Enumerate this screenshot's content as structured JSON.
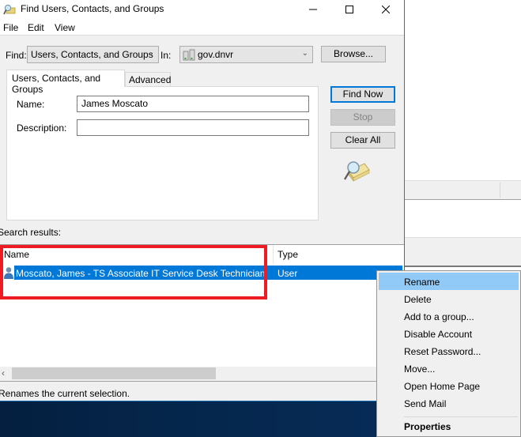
{
  "window": {
    "title": "Find Users, Contacts, and Groups",
    "controls": [
      "minimize",
      "maximize",
      "close"
    ]
  },
  "menubar": {
    "items": [
      "File",
      "Edit",
      "View"
    ]
  },
  "find": {
    "find_label": "Find:",
    "find_value": "Users, Contacts, and Groups",
    "in_label": "In:",
    "in_value": "gov.dnvr",
    "browse_label": "Browse..."
  },
  "tabs": [
    {
      "label": "Users, Contacts, and Groups",
      "active": true
    },
    {
      "label": "Advanced",
      "active": false
    }
  ],
  "form": {
    "name_label": "Name:",
    "name_value": "James Moscato",
    "description_label": "Description:",
    "description_value": ""
  },
  "buttons": {
    "find_now": "Find Now",
    "stop": "Stop",
    "clear_all": "Clear All"
  },
  "results": {
    "label": "Search results:",
    "columns": [
      "Name",
      "Type"
    ],
    "rows": [
      {
        "name": "Moscato, James - TS Associate IT Service Desk Technician",
        "type": "User",
        "selected": true
      }
    ]
  },
  "status": {
    "text": "Renames the current selection."
  },
  "context_menu": {
    "items": [
      {
        "label": "Rename",
        "highlighted": true
      },
      {
        "label": "Delete"
      },
      {
        "label": "Add to a group..."
      },
      {
        "label": "Disable Account"
      },
      {
        "label": "Reset Password..."
      },
      {
        "label": "Move..."
      },
      {
        "label": "Open Home Page"
      },
      {
        "label": "Send Mail"
      },
      {
        "label": "Properties",
        "bold": true
      }
    ]
  },
  "colors": {
    "selection": "#0078d7",
    "menu_highlight": "#91c9f7",
    "annotation_box": "#ed1c24"
  }
}
